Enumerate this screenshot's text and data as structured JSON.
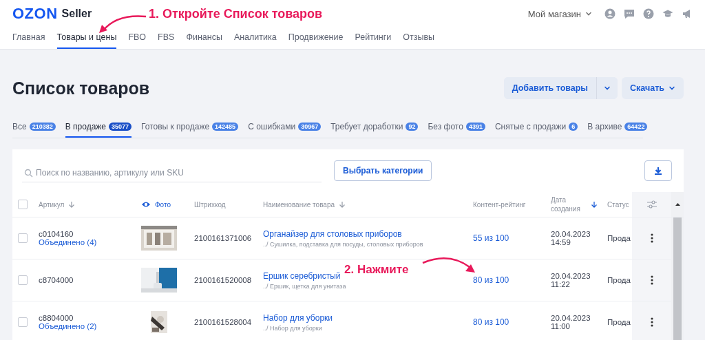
{
  "header": {
    "logo": "OZON",
    "logo_suffix": "Seller",
    "store": "Мой магазин",
    "nav": [
      {
        "label": "Главная",
        "selected": false
      },
      {
        "label": "Товары и цены",
        "selected": true
      },
      {
        "label": "FBO",
        "selected": false
      },
      {
        "label": "FBS",
        "selected": false
      },
      {
        "label": "Финансы",
        "selected": false
      },
      {
        "label": "Аналитика",
        "selected": false
      },
      {
        "label": "Продвижение",
        "selected": false
      },
      {
        "label": "Рейтинги",
        "selected": false
      },
      {
        "label": "Отзывы",
        "selected": false
      }
    ]
  },
  "page": {
    "title": "Список товаров",
    "add_button": "Добавить товары",
    "download_button": "Скачать"
  },
  "tabs": [
    {
      "label": "Все",
      "count": "210382",
      "selected": false
    },
    {
      "label": "В продаже",
      "count": "35077",
      "selected": true
    },
    {
      "label": "Готовы к продаже",
      "count": "142485",
      "selected": false
    },
    {
      "label": "С ошибками",
      "count": "30967",
      "selected": false
    },
    {
      "label": "Требует доработки",
      "count": "92",
      "selected": false
    },
    {
      "label": "Без фото",
      "count": "4391",
      "selected": false
    },
    {
      "label": "Снятые с продажи",
      "count": "6",
      "selected": false
    },
    {
      "label": "В архиве",
      "count": "64422",
      "selected": false
    }
  ],
  "toolbar": {
    "search_placeholder": "Поиск по названию, артикулу или SKU",
    "category_button": "Выбрать категории"
  },
  "table": {
    "all_checked": false,
    "columns": [
      {
        "label": "Артикул",
        "sortable": true,
        "sorted": false,
        "highlighted": false
      },
      {
        "label": "Фото",
        "sortable": false,
        "highlighted": true
      },
      {
        "label": "Штрихкод",
        "sortable": false,
        "highlighted": false
      },
      {
        "label": "Наименование товара",
        "sortable": true,
        "sorted": false,
        "highlighted": false
      },
      {
        "label": "Контент-рейтинг",
        "sortable": false,
        "highlighted": false
      },
      {
        "label": "Дата создания",
        "sortable": true,
        "sorted": true,
        "highlighted": false
      },
      {
        "label": "Статус",
        "sortable": false,
        "highlighted": false
      }
    ],
    "rows": [
      {
        "checked": false,
        "article": "c0104160",
        "merged": "Объединено (4)",
        "barcode": "2100161371006",
        "name": "Органайзер для столовых приборов",
        "category": "../ Сушилка, подставка для посуды, столовых приборов",
        "rating": "55 из 100",
        "date": "20.04.2023",
        "time": "14:59",
        "status": "Прода"
      },
      {
        "checked": false,
        "article": "c8704000",
        "barcode": "2100161520008",
        "name": "Ершик серебристый",
        "category": "../ Ершик, щетка для унитаза",
        "rating": "80 из 100",
        "date": "20.04.2023",
        "time": "11:22",
        "status": "Прода"
      },
      {
        "checked": false,
        "article": "c8804000",
        "merged": "Объединено (2)",
        "barcode": "2100161528004",
        "name": "Набор для уборки",
        "category": "../ Набор для уборки",
        "rating": "80 из 100",
        "date": "20.04.2023",
        "time": "11:00",
        "status": "Прода"
      }
    ]
  },
  "annotations": [
    {
      "text": "1. Откройте Список товаров"
    },
    {
      "text": "2. Нажмите"
    }
  ]
}
